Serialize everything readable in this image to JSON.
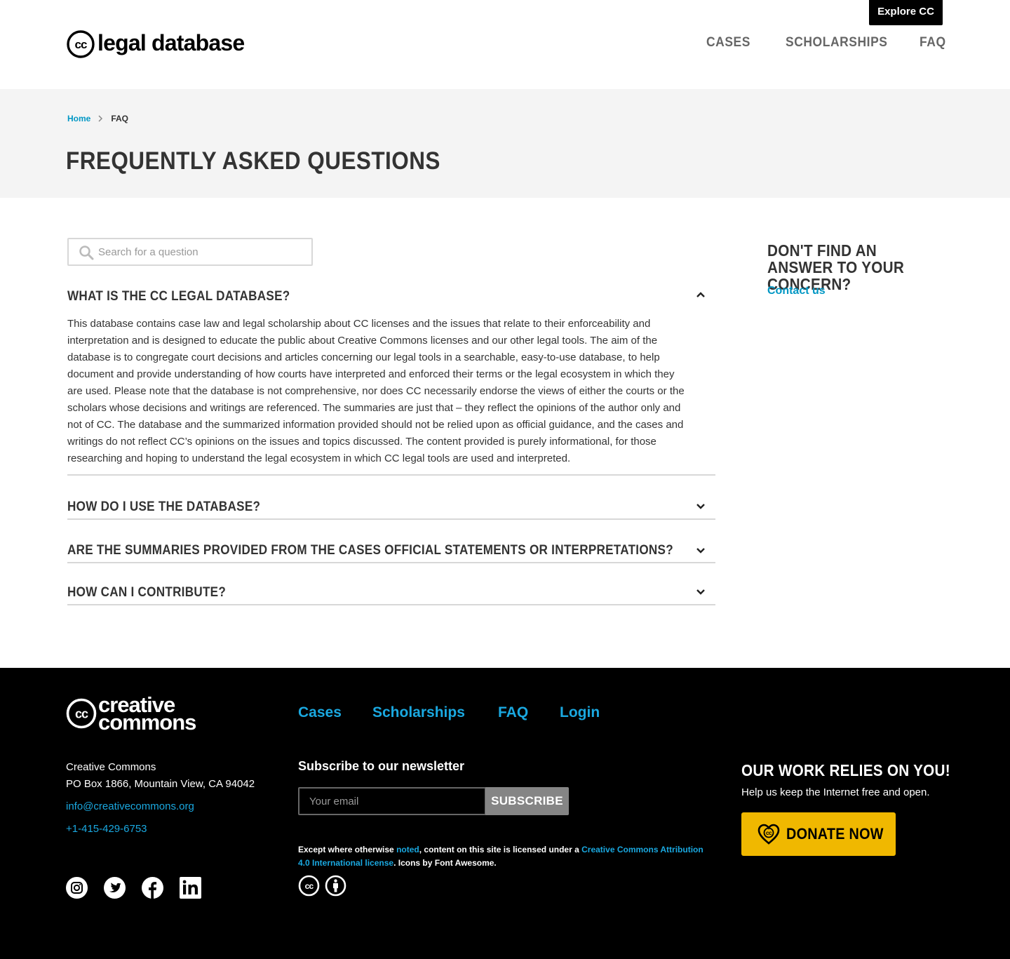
{
  "header": {
    "explore_label": "Explore CC",
    "logo_text": "legal database",
    "nav": [
      "CASES",
      "SCHOLARSHIPS",
      "FAQ"
    ]
  },
  "breadcrumb": {
    "home": "Home",
    "current": "FAQ"
  },
  "page_title": "FREQUENTLY ASKED QUESTIONS",
  "search": {
    "placeholder": "Search for a question",
    "value": ""
  },
  "faq": [
    {
      "question": "WHAT IS THE CC LEGAL DATABASE?",
      "expanded": true,
      "answer": "This database contains case law and legal scholarship about CC licenses and the issues that relate to their enforceability and interpretation and is designed to educate the public about Creative Commons licenses and our other legal tools. The aim of the database is to congregate court decisions and articles concerning our legal tools in a searchable, easy-to-use database, to help document and provide understanding of how courts have interpreted and enforced their terms or the legal ecosystem in which they are used. Please note that the database is not comprehensive, nor does CC necessarily endorse the views of either the courts or the scholars whose decisions and writings are referenced. The summaries are just that – they reflect the opinions of the author only and not of CC. The database and the summarized information provided should not be relied upon as official guidance, and the cases and writings do not reflect CC’s opinions on the issues and topics discussed. The content provided is purely informational, for those researching and hoping to understand the legal ecosystem in which CC legal tools are used and interpreted."
    },
    {
      "question": "HOW DO I USE THE DATABASE?",
      "expanded": false
    },
    {
      "question": "ARE THE SUMMARIES PROVIDED FROM THE CASES OFFICIAL STATEMENTS OR INTERPRETATIONS?",
      "expanded": false
    },
    {
      "question": "HOW CAN I CONTRIBUTE?",
      "expanded": false
    }
  ],
  "sidebar": {
    "title": "DON'T FIND AN ANSWER TO YOUR CONCERN?",
    "link": "Contact us"
  },
  "footer": {
    "logo_line1": "creative",
    "logo_line2": "commons",
    "address_line1": "Creative Commons",
    "address_line2": "PO Box 1866, Mountain View, CA 94042",
    "email": "info@creativecommons.org",
    "phone": "+1-415-429-6753",
    "social_icons": [
      "instagram-icon",
      "twitter-icon",
      "facebook-icon",
      "linkedin-icon"
    ],
    "nav": [
      "Cases",
      "Scholarships",
      "FAQ",
      "Login"
    ],
    "newsletter_title": "Subscribe to our newsletter",
    "email_placeholder": "Your email",
    "subscribe_label": "SUBSCRIBE",
    "license": {
      "t1": "Except where otherwise ",
      "link1": "noted",
      "t2": ", content on this site is licensed under a ",
      "link2": "Creative Commons Attribution 4.0 International license",
      "t3": ". Icons by Font Awesome."
    },
    "donate_title": "OUR WORK RELIES ON YOU!",
    "donate_sub": "Help us keep the Internet free and open.",
    "donate_label": "DONATE NOW"
  },
  "colors": {
    "link_blue": "#0097c4",
    "footer_link_blue": "#1aa8e0",
    "donate_yellow": "#f0b800",
    "hero_bg": "#f4f4f4",
    "footer_bg": "#000000"
  }
}
